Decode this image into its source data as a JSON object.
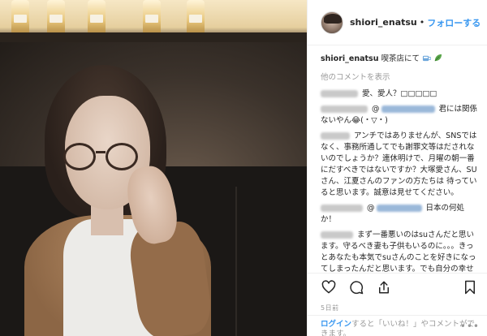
{
  "post": {
    "username": "shiori_enatsu",
    "dot": "•",
    "follow_label": "フォローする"
  },
  "caption": {
    "username": "shiori_enatsu",
    "text": "喫茶店にて"
  },
  "view_more": "他のコメントを表示",
  "comments": [
    {
      "text": "愛、愛人？□□□□□"
    },
    {
      "text_before": "@",
      "text_after": " 君には関係ないやん😂(・▽・)"
    },
    {
      "text": "アンチではありませんが、SNSではなく、事務所通してでも謝罪文等はだされないのでしょうか？連休明けで、月曜の朝一番にだすべきではないですか？大塚愛さん、SUさん、江夏さんのファンの方たちは 待っていると思います。誠意は見せてください。"
    },
    {
      "text_before": "@",
      "text_after": " 日本の何処か！"
    },
    {
      "text": "まず一番悪いのはsuさんだと思います。守るべき妻も子供もいるのに。。。きっとあなたも本気でsuさんのことを好きになってしまったんだと思います。でも自分の幸せと引き換えに誰かを不"
    }
  ],
  "time_ago": "5日前",
  "login_bar": {
    "link": "ログイン",
    "text": "すると「いいね！」やコメントができます。"
  },
  "icons": {
    "follow_dot": "dot",
    "like": "heart-icon",
    "comment": "comment-icon",
    "share": "share-icon",
    "save": "bookmark-icon",
    "more": "more-options-icon"
  },
  "colors": {
    "link": "#3897f0",
    "muted": "#999999",
    "text": "#262626"
  }
}
